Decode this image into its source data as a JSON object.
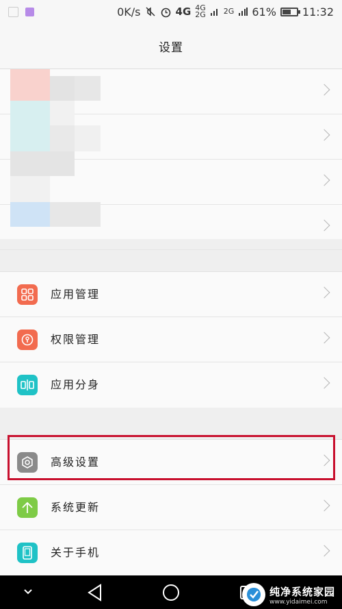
{
  "status_bar": {
    "speed": "0K/s",
    "network_4g": "4G",
    "network_4g_small": "4G",
    "network_2g_small_a": "2G",
    "network_2g_small_b": "2G",
    "battery_level": 0.61,
    "battery_text": "61%",
    "time": "11:32"
  },
  "header": {
    "title": "设置"
  },
  "section_apps": {
    "items": [
      {
        "label": "应用管理",
        "icon": "apps-grid-icon",
        "color": "#f26b4f"
      },
      {
        "label": "权限管理",
        "icon": "key-lock-icon",
        "color": "#f26b4f"
      },
      {
        "label": "应用分身",
        "icon": "twin-app-icon",
        "color": "#1fc2c6"
      }
    ]
  },
  "section_system": {
    "items": [
      {
        "label": "高级设置",
        "icon": "gear-icon",
        "color": "#8a8a8a"
      },
      {
        "label": "系统更新",
        "icon": "arrow-up-icon",
        "color": "#7ecb46"
      },
      {
        "label": "关于手机",
        "icon": "phone-icon",
        "color": "#1fc2c6"
      }
    ]
  },
  "watermark": {
    "title": "纯净系统家园",
    "url": "www.yidaimei.com"
  },
  "colors": {
    "highlight": "#c8102e"
  }
}
